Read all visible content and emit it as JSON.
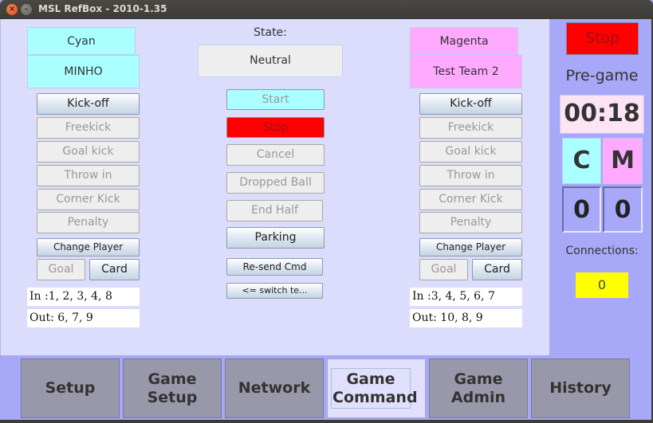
{
  "window": {
    "title": "MSL RefBox  - 2010-1.35",
    "close_icon": "×",
    "minimize_icon": "–"
  },
  "colors": {
    "cyan_team": "#aaffff",
    "magenta_team": "#ffaaff",
    "stop": "#ff0000",
    "connections": "#ffff00",
    "panel_bg": "#dcdcfc",
    "side_bg": "#a8a8f8"
  },
  "left_team": {
    "color_label": "Cyan",
    "name": "MINHO",
    "buttons": {
      "kickoff": "Kick-off",
      "freekick": "Freekick",
      "goal_kick": "Goal kick",
      "throw_in": "Throw in",
      "corner_kick": "Corner Kick",
      "penalty": "Penalty",
      "change_player": "Change Player",
      "goal": "Goal",
      "card": "Card"
    },
    "players_in": "In :1, 2, 3, 4, 8",
    "players_out": "Out: 6, 7, 9"
  },
  "right_team": {
    "color_label": "Magenta",
    "name": "Test Team 2",
    "buttons": {
      "kickoff": "Kick-off",
      "freekick": "Freekick",
      "goal_kick": "Goal kick",
      "throw_in": "Throw in",
      "corner_kick": "Corner Kick",
      "penalty": "Penalty",
      "change_player": "Change Player",
      "goal": "Goal",
      "card": "Card"
    },
    "players_in": "In :3, 4, 5, 6, 7",
    "players_out": "Out: 10, 8, 9"
  },
  "center": {
    "state_label": "State:",
    "state_value": "Neutral",
    "buttons": {
      "start": "Start",
      "stop": "Stop",
      "cancel": "Cancel",
      "dropped_ball": "Dropped Ball",
      "end_half": "End Half",
      "parking": "Parking",
      "resend": "Re-send Cmd",
      "switch_teams": "<= switch te..."
    }
  },
  "side": {
    "stop_label": "Stop",
    "phase": "Pre-game",
    "clock": "00:18",
    "cyan_short": "C",
    "magenta_short": "M",
    "cyan_score": "0",
    "magenta_score": "0",
    "connections_label": "Connections:",
    "connections_value": "0"
  },
  "tabs": [
    {
      "label": "Setup",
      "selected": false
    },
    {
      "label": "Game Setup",
      "selected": false
    },
    {
      "label": "Network",
      "selected": false
    },
    {
      "label": "Game Command",
      "selected": true
    },
    {
      "label": "Game Admin",
      "selected": false
    },
    {
      "label": "History",
      "selected": false
    }
  ]
}
